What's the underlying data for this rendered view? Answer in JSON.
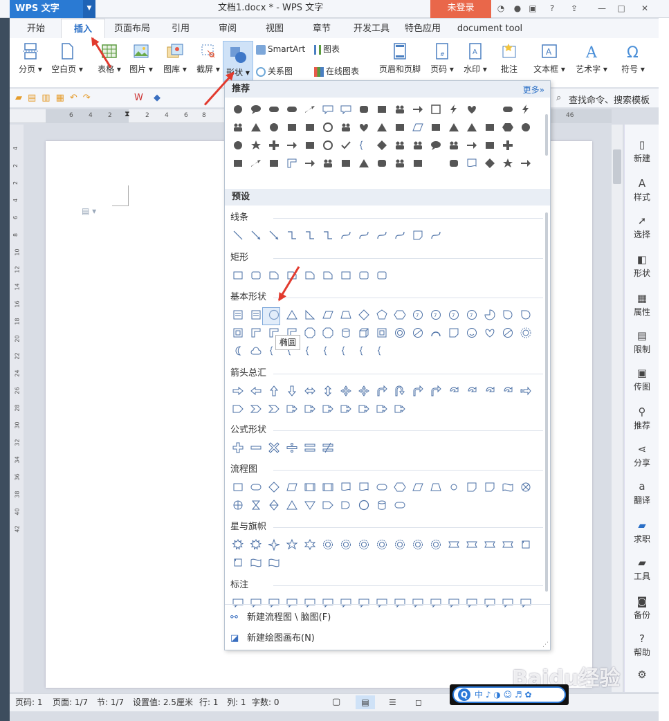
{
  "app": {
    "logo": "WPS 文字",
    "doc_title": "文档1.docx * - WPS 文字",
    "login": "未登录"
  },
  "tabs": [
    "开始",
    "插入",
    "页面布局",
    "引用",
    "审阅",
    "视图",
    "章节",
    "开发工具",
    "特色应用",
    "document tool"
  ],
  "ribbon": {
    "fenye": "分页",
    "kongbaiye": "空白页",
    "biaoge": "表格",
    "tupian": "图片",
    "tuku": "图库",
    "jieping": "截屏",
    "xingzhuang": "形状",
    "smartart": "SmartArt",
    "guanxitu": "关系图",
    "tubiao": "图表",
    "zaixiantubiao": "在线图表",
    "yemeiyejiao": "页眉和页脚",
    "yema": "页码",
    "shuiyin": "水印",
    "pizhu": "批注",
    "wenbenkuang": "文本框",
    "yishuzi": "艺术字",
    "fuhao": "符号"
  },
  "quickbar": {
    "search": "查找命令、搜索模板"
  },
  "ruler_ticks": [
    "6",
    "4",
    "2",
    "2",
    "4",
    "6",
    "8",
    "46"
  ],
  "vruler_ticks": [
    "4",
    "2",
    "2",
    "4",
    "6",
    "8",
    "10",
    "12",
    "14",
    "16",
    "18",
    "20",
    "22",
    "24",
    "26",
    "28",
    "30",
    "32",
    "34",
    "36",
    "38",
    "40",
    "42"
  ],
  "sidebar": [
    "新建",
    "样式",
    "选择",
    "形状",
    "属性",
    "限制",
    "传图",
    "推荐",
    "分享",
    "翻译",
    "求职",
    "工具",
    "备份",
    "帮助"
  ],
  "panel": {
    "recommend": "推荐",
    "more": "更多»",
    "preset": "预设",
    "categories": [
      "线条",
      "矩形",
      "基本形状",
      "箭头总汇",
      "公式形状",
      "流程图",
      "星与旗帜",
      "标注"
    ],
    "footer1": "新建流程图 \\ 脑图(F)",
    "footer2": "新建绘图画布(N)",
    "tooltip": "椭圆"
  },
  "status": {
    "page": "页码: 1",
    "pages": "页面: 1/7",
    "section": "节: 1/7",
    "setting": "设置值: 2.5厘米",
    "row": "行: 1",
    "col": "列: 1",
    "words": "字数: 0"
  },
  "ime": "中 ♪ ◑ ☺ ♬ ✿",
  "watermark": "Baidu经验",
  "colors": {
    "accent": "#2a7ad3",
    "login": "#e9674a",
    "arrow": "#e23a2e"
  }
}
